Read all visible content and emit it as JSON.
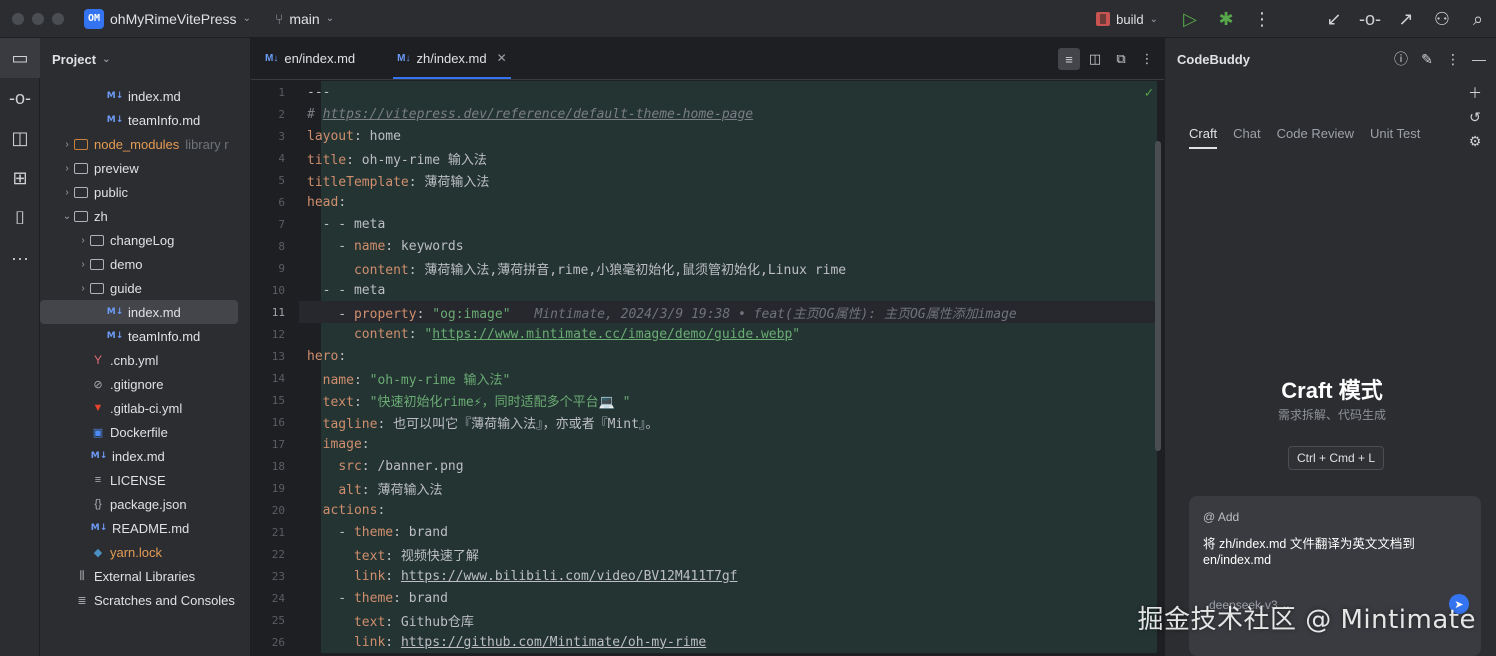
{
  "titlebar": {
    "project_badge": "OM",
    "project_name": "ohMyRimeVitePress",
    "branch": "main",
    "run_config": "build",
    "icons": [
      "run-icon",
      "debug-icon",
      "more-icon",
      "vcs-update-icon",
      "vcs-commit-icon",
      "vcs-push-icon",
      "add-user-icon",
      "search-icon"
    ]
  },
  "activity": {
    "icons": [
      "folder-icon",
      "commit-icon",
      "structure-icon",
      "plugins-icon",
      "bookmark-icon",
      "more-icon"
    ]
  },
  "project_panel": {
    "title": "Project",
    "tree": [
      {
        "label": "index.md",
        "type": "md",
        "indent": 3
      },
      {
        "label": "teamInfo.md",
        "type": "md",
        "indent": 3
      },
      {
        "label": "node_modules",
        "type": "folder-orange",
        "indent": 1,
        "sub": "library r"
      },
      {
        "label": "preview",
        "type": "folder",
        "indent": 1
      },
      {
        "label": "public",
        "type": "folder",
        "indent": 1
      },
      {
        "label": "zh",
        "type": "folder-open",
        "indent": 1
      },
      {
        "label": "changeLog",
        "type": "folder",
        "indent": 2
      },
      {
        "label": "demo",
        "type": "folder",
        "indent": 2
      },
      {
        "label": "guide",
        "type": "folder",
        "indent": 2
      },
      {
        "label": "index.md",
        "type": "md",
        "indent": 3,
        "selected": true
      },
      {
        "label": "teamInfo.md",
        "type": "md",
        "indent": 3
      },
      {
        "label": ".cnb.yml",
        "type": "yml",
        "indent": 2
      },
      {
        "label": ".gitignore",
        "type": "ignore",
        "indent": 2
      },
      {
        "label": ".gitlab-ci.yml",
        "type": "gitlab",
        "indent": 2
      },
      {
        "label": "Dockerfile",
        "type": "docker",
        "indent": 2
      },
      {
        "label": "index.md",
        "type": "md",
        "indent": 2
      },
      {
        "label": "LICENSE",
        "type": "license",
        "indent": 2
      },
      {
        "label": "package.json",
        "type": "json",
        "indent": 2
      },
      {
        "label": "README.md",
        "type": "md",
        "indent": 2
      },
      {
        "label": "yarn.lock",
        "type": "yarn",
        "indent": 2
      },
      {
        "label": "External Libraries",
        "type": "lib",
        "indent": 1
      },
      {
        "label": "Scratches and Consoles",
        "type": "scratch",
        "indent": 1
      }
    ]
  },
  "editor": {
    "tabs": [
      {
        "label": "en/index.md",
        "active": false
      },
      {
        "label": "zh/index.md",
        "active": true
      }
    ],
    "md_badge": "M↓",
    "current_line": 11,
    "blame": "Mintimate, 2024/3/9 19:38 • feat(主页OG属性): 主页OG属性添加image",
    "line_numbers": [
      "1",
      "2",
      "3",
      "4",
      "5",
      "6",
      "7",
      "8",
      "9",
      "10",
      "11",
      "12",
      "13",
      "14",
      "15",
      "16",
      "17",
      "18",
      "19",
      "20",
      "21",
      "22",
      "23",
      "24",
      "25",
      "26"
    ]
  },
  "buddy": {
    "title": "CodeBuddy",
    "tabs": [
      "Craft",
      "Chat",
      "Code Review",
      "Unit Test"
    ],
    "active_tab": "Craft",
    "craft_title": "Craft 模式",
    "craft_subtitle": "需求拆解、代码生成",
    "shortcut": "Ctrl + Cmd + L",
    "add_context": "@ Add",
    "prompt": "将 zh/index.md 文件翻译为英文文档到 en/index.md",
    "model": "deepseek-v3"
  },
  "watermark": "掘金技术社区 @ Mintimate",
  "colors": {
    "accent": "#3574f0",
    "green": "#57a64a",
    "keyword": "#cf8e6d",
    "string": "#6aab73",
    "comment": "#7a7e85",
    "highlight_bg": "#243433"
  }
}
